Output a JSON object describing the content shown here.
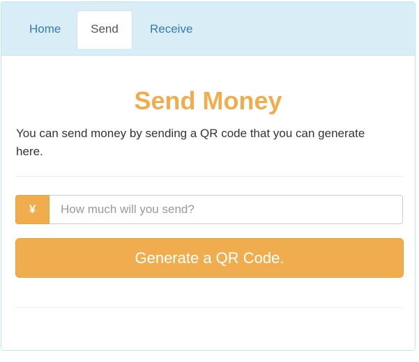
{
  "nav": {
    "tabs": [
      {
        "label": "Home",
        "active": false
      },
      {
        "label": "Send",
        "active": true
      },
      {
        "label": "Receive",
        "active": false
      }
    ]
  },
  "main": {
    "title": "Send Money",
    "description": "You can send money by sending a QR code that you can generate here.",
    "amount": {
      "currency_symbol": "¥",
      "placeholder": "How much will you send?",
      "value": ""
    },
    "generate_button_label": "Generate a QR Code."
  },
  "colors": {
    "accent": "#f0ad4e",
    "heading_bg": "#d9edf7",
    "link": "#337ab7"
  }
}
